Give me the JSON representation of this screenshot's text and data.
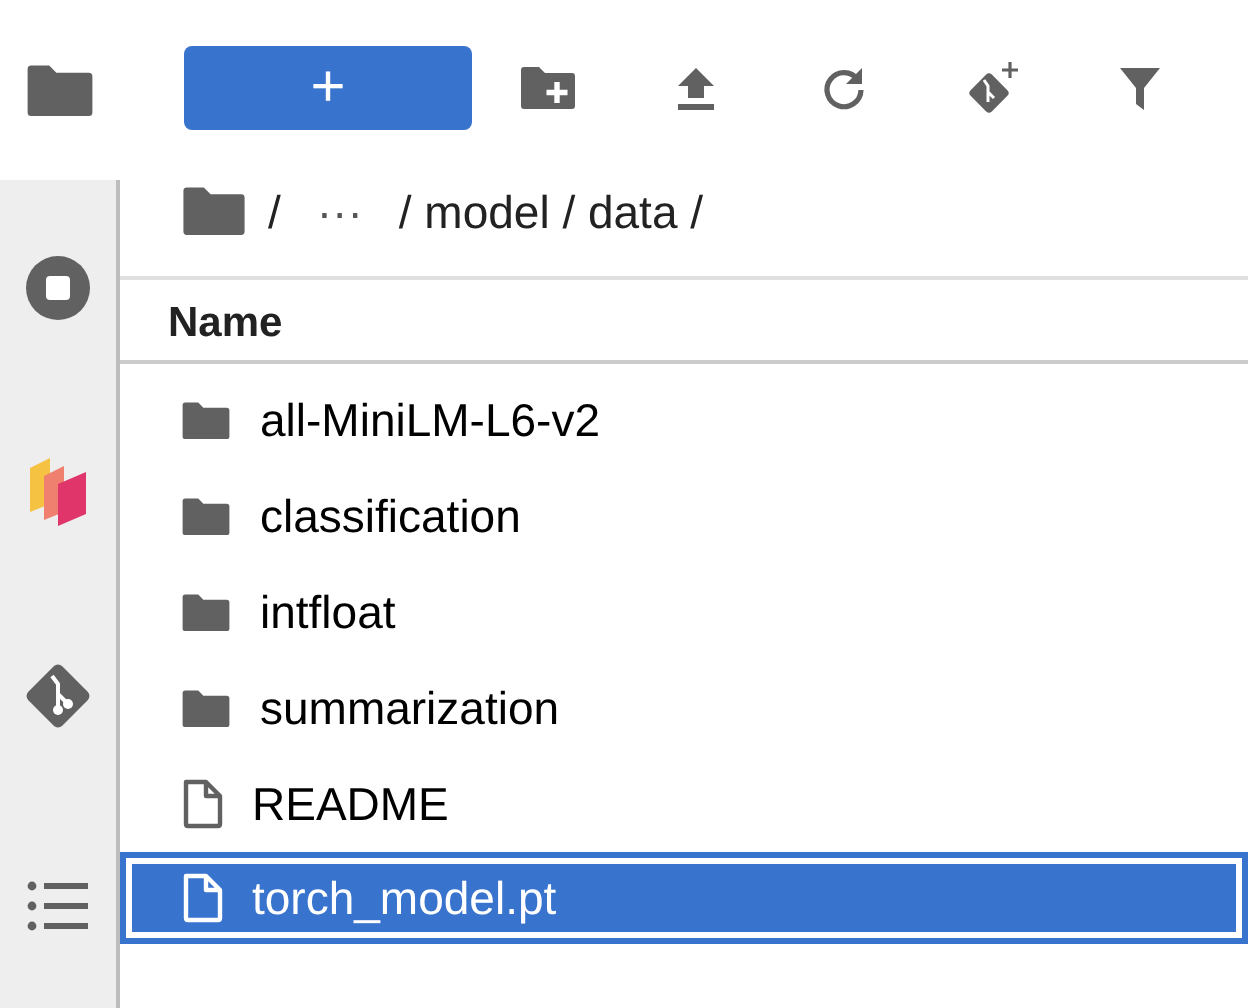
{
  "sidebar": {
    "items": [
      {
        "kind": "folder",
        "selected": true
      },
      {
        "kind": "running",
        "selected": false
      },
      {
        "kind": "extensions",
        "selected": false
      },
      {
        "kind": "git",
        "selected": false
      },
      {
        "kind": "toc",
        "selected": false
      }
    ]
  },
  "toolbar": {
    "new_button": "+",
    "tools": [
      {
        "kind": "new-folder"
      },
      {
        "kind": "upload"
      },
      {
        "kind": "refresh"
      },
      {
        "kind": "git-clone"
      },
      {
        "kind": "filter"
      }
    ]
  },
  "breadcrumb": {
    "parts": [
      "/",
      "···",
      "/ model / data /"
    ]
  },
  "table": {
    "columns": [
      "Name"
    ],
    "rows": [
      {
        "kind": "folder",
        "name": "all-MiniLM-L6-v2",
        "selected": false
      },
      {
        "kind": "folder",
        "name": "classification",
        "selected": false
      },
      {
        "kind": "folder",
        "name": "intfloat",
        "selected": false
      },
      {
        "kind": "folder",
        "name": "summarization",
        "selected": false
      },
      {
        "kind": "file",
        "name": "README",
        "selected": false
      },
      {
        "kind": "file",
        "name": "torch_model.pt",
        "selected": true
      }
    ]
  }
}
